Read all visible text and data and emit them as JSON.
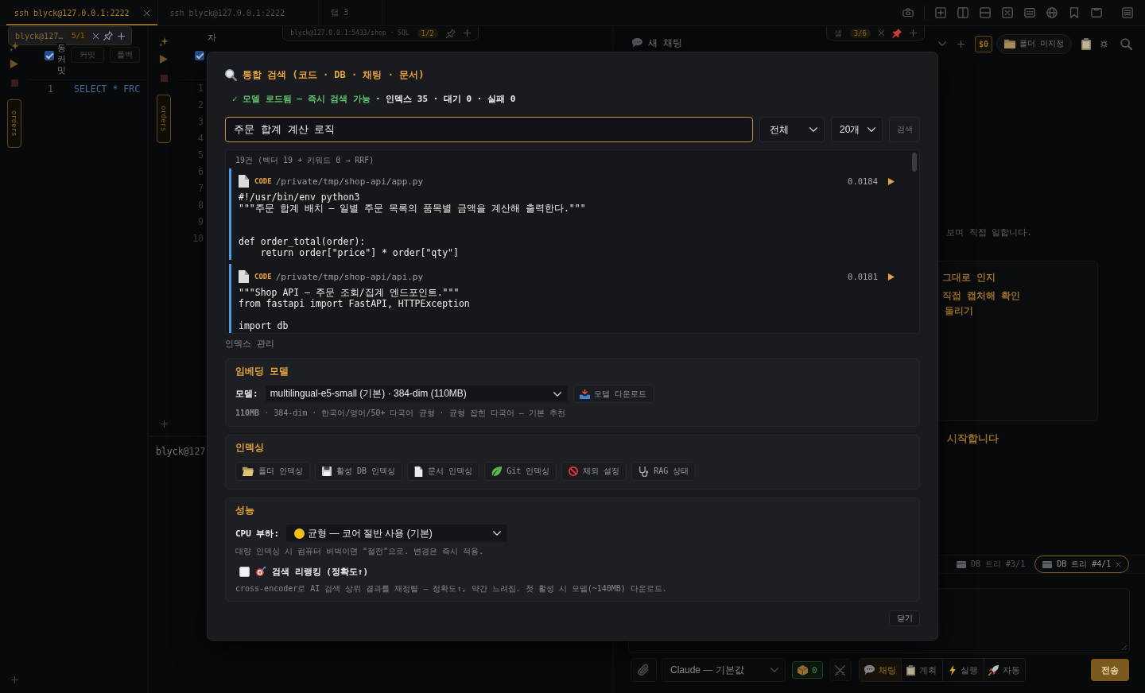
{
  "top_tabs": [
    {
      "label": "ssh blyck@127.0.0.1:2222",
      "selected": true
    },
    {
      "label": "ssh blyck@127.0.0.1:2222",
      "selected": false
    },
    {
      "label": "탭 3",
      "selected": false
    }
  ],
  "left_pane": {
    "tab": {
      "label": "blyck@127…",
      "badge": "5/1",
      "active": true,
      "closable": true,
      "pinned": false
    },
    "auto_commit": {
      "label": "동커밋",
      "checked": true
    },
    "buttons": [
      "커밋",
      "롤백"
    ],
    "line_numbers": [
      "1"
    ],
    "code": "SELECT * FRC",
    "side_tab": "orders"
  },
  "middle_pane": {
    "tab": {
      "label": "blyck@127.0.0.1:5433/shop · SQL",
      "badge": "1/2",
      "active": false,
      "closable": false,
      "pinned": false
    },
    "auto_commit": {
      "label": "자",
      "checked": true
    },
    "line_numbers": [
      "1",
      "2",
      "3",
      "4",
      "5",
      "6",
      "7",
      "8",
      "9",
      "10"
    ],
    "side_tab": "orders",
    "terminal": "blyck@127"
  },
  "right_pane": {
    "chat_title": "새 채팅",
    "tab": {
      "label": "셀",
      "badge": "3/6",
      "active": false,
      "closable": true,
      "pinned": true
    },
    "cost": "$0",
    "folder": "폴더 미지정",
    "intro": "보며 직접 일합니다.",
    "list_items": [
      "그대로 인지",
      "직접 캡처해 확인",
      "돌리기"
    ],
    "heading": "시작합니다",
    "db_tabs": [
      {
        "label": "DB 트리 #3/1",
        "selected": false
      },
      {
        "label": "DB 트리 #4/1",
        "selected": true
      }
    ],
    "model": "Claude — 기본값",
    "box_count": "0",
    "modes": [
      {
        "kind": "chat",
        "label": "채팅",
        "selected": true
      },
      {
        "kind": "plan",
        "label": "계획",
        "selected": false
      },
      {
        "kind": "run",
        "label": "실행",
        "selected": false
      },
      {
        "kind": "auto",
        "label": "자동",
        "selected": false
      }
    ],
    "send": "전송"
  },
  "search_dialog": {
    "title": "통합 검색 (코드 · DB · 채팅 · 문서)",
    "model_status": "✓ 모델 로드됨 — 즉시 검색 가능",
    "index_stats": "· 인덱스 35 · 대기 0 · 실패 0",
    "query": "주문 합계 계산 로직",
    "scope": "전체",
    "limit": "20개",
    "search_button": "검색",
    "results_summary": "19건 (벡터 19 + 키워드 0 → RRF)",
    "results": [
      {
        "kind": "code",
        "tag": "CODE",
        "path": "/private/tmp/shop-api/app.py",
        "score": "0.0184",
        "snippet": "#!/usr/bin/env python3\n\"\"\"주문 합계 배치 — 일별 주문 목록의 품목별 금액을 계산해 출력한다.\"\"\"\n\n\ndef order_total(order):\n    return order[\"price\"] * order[\"qty\"]"
      },
      {
        "kind": "code",
        "tag": "CODE",
        "path": "/private/tmp/shop-api/api.py",
        "score": "0.0181",
        "snippet": "\"\"\"Shop API — 주문 조회/집계 엔드포인트.\"\"\"\nfrom fastapi import FastAPI, HTTPException\n\nimport db"
      }
    ],
    "index_heading": "인덱스 관리",
    "embedding": {
      "title": "임베딩 모델",
      "label": "모델:",
      "model": "multilingual-e5-small (기본) · 384-dim (110MB)",
      "download": "모델 다운로드",
      "details": "**110MB** · 384-dim · 한국어/영어/50+ 다국어 균형 · 균형 잡힌 다국어 — 기본 추천"
    },
    "indexing": {
      "title": "인덱싱",
      "actions": [
        {
          "kind": "folder",
          "label": "폴더 인덱싱"
        },
        {
          "kind": "database",
          "label": "활성 DB 인덱싱"
        },
        {
          "kind": "document",
          "label": "문서 인덱싱"
        },
        {
          "kind": "git",
          "label": "Git 인덱싱"
        },
        {
          "kind": "exclude",
          "label": "제외 설정"
        },
        {
          "kind": "status",
          "label": "RAG 상태"
        }
      ]
    },
    "performance": {
      "title": "성능",
      "cpu_label": "CPU 부하:",
      "cpu_mode": "균형 — 코어 절반 사용 (기본)",
      "cpu_hint": "대량 인덱싱 시 컴퓨터 버벅이면 \"절전\"으로. 변경은 즉시 적용.",
      "rerank": {
        "label": "검색 리랭킹 (정확도↑)",
        "checked": false
      },
      "rerank_hint": "cross-encoder로 AI 검색 상위 결과를 재정렬 — 정확도↑, 약간 느려짐. 첫 활성 시 모델(~140MB) 다운로드."
    },
    "close": "닫기"
  }
}
